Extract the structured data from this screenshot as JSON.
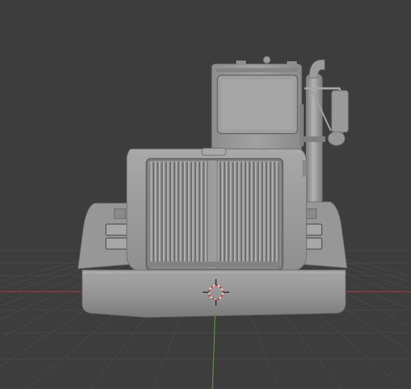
{
  "viewport": {
    "mode": "Solid",
    "shading": "Studio",
    "background_color": "#3d3d3d",
    "grid_color": "#4a4a4a",
    "x_axis_color": "#a43f45",
    "y_axis_color": "#6b9b3a",
    "model_color": "#9a9a9a",
    "model_highlight": "#b3b3b3",
    "model_shadow": "#6e6e6e",
    "model_dark": "#4e4e4e",
    "cursor_primary": "#e8e8e8",
    "cursor_secondary": "#d33a3a"
  },
  "scene": {
    "object": "truck-front",
    "objects": [
      "cab",
      "exhaust-stack",
      "side-mirror",
      "hood",
      "radiator-grille",
      "fenders",
      "headlights",
      "front-bumper"
    ],
    "gizmo": "3d-cursor"
  }
}
